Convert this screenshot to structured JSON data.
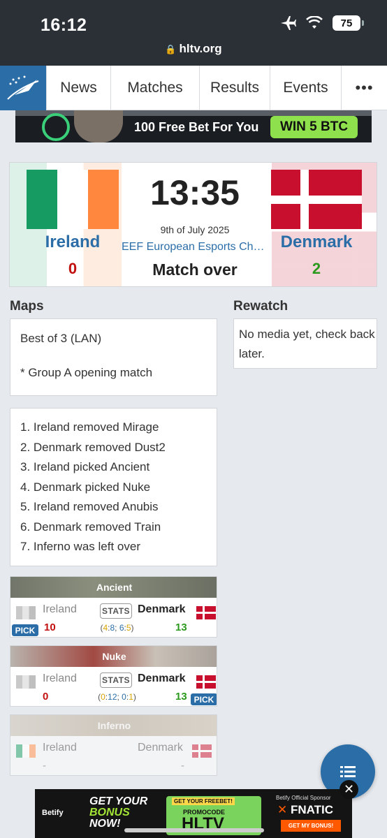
{
  "status_bar": {
    "time": "16:12",
    "battery": "75",
    "url": "hltv.org",
    "icons": [
      "airplane-icon",
      "wifi-icon",
      "battery-icon",
      "lock-icon"
    ]
  },
  "nav": {
    "items": [
      "News",
      "Matches",
      "Results",
      "Events",
      "•••"
    ]
  },
  "banner_top": {
    "text": "100 Free Bet For You",
    "button": "WIN 5 BTC"
  },
  "match": {
    "team1": {
      "name": "Ireland",
      "score": "0"
    },
    "team2": {
      "name": "Denmark",
      "score": "2"
    },
    "time": "13:35",
    "date": "9th of July 2025",
    "event": "EEF European Esports Championship",
    "status": "Match over"
  },
  "maps_section": {
    "title": "Maps",
    "format_line1": "Best of 3 (LAN)",
    "format_line2": "* Group A opening match",
    "veto": [
      "1. Ireland removed Mirage",
      "2. Denmark removed Dust2",
      "3. Ireland picked Ancient",
      "4. Denmark picked Nuke",
      "5. Ireland removed Anubis",
      "6. Denmark removed Train",
      "7. Inferno was left over"
    ]
  },
  "rewatch": {
    "title": "Rewatch",
    "text": "No media yet, check back later."
  },
  "map_results": [
    {
      "map": "Ancient",
      "team1": "Ireland",
      "team2": "Denmark",
      "score1": "10",
      "score2": "13",
      "stats": "STATS",
      "halves_open": "(",
      "h1": "4",
      "h1b": "8",
      "h2": "6",
      "h2b": "5",
      "pick": "PICK"
    },
    {
      "map": "Nuke",
      "team1": "Ireland",
      "team2": "Denmark",
      "score1": "0",
      "score2": "13",
      "stats": "STATS",
      "halves_open": "(",
      "h1": "0",
      "h1b": "12",
      "h2": "0",
      "h2b": "1",
      "pick": "PICK"
    },
    {
      "map": "Inferno",
      "team1": "Ireland",
      "team2": "Denmark",
      "score1": "-",
      "score2": "-"
    }
  ],
  "ad_bottom": {
    "brand": "Betify",
    "headline1": "GET YOUR",
    "headline2": "BONUS",
    "headline3": "NOW!",
    "ticket_tag": "GET YOUR FREEBET!",
    "promocode": "PROMOCODE",
    "code": "HLTV",
    "sponsor": "Betify Official Sponsor",
    "team": "FNATIC",
    "cta": "GET MY BONUS!"
  },
  "colors": {
    "accent": "#2b6ea7",
    "win": "#2a9a1c",
    "loss": "#c21010",
    "ireland": [
      "#169b62",
      "#ffffff",
      "#ff883e"
    ],
    "denmark": [
      "#c8102e",
      "#ffffff"
    ]
  }
}
